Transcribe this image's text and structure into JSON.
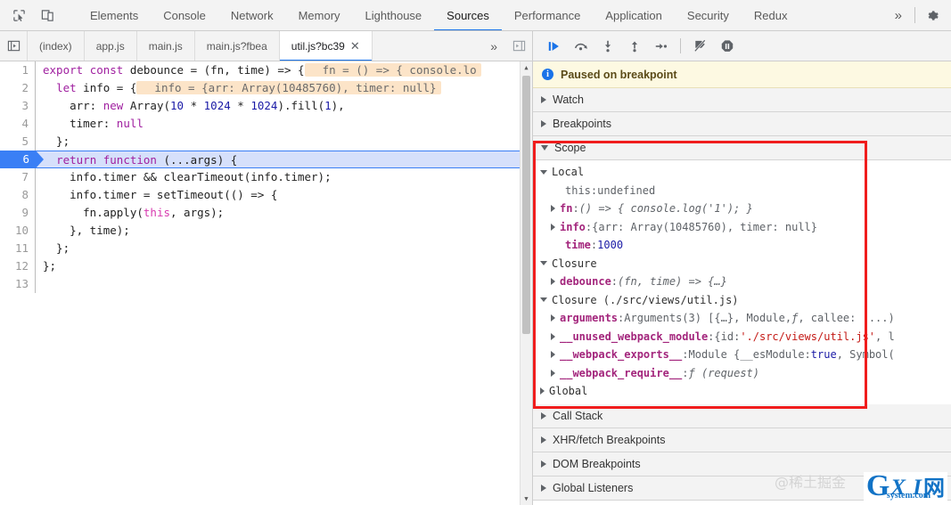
{
  "toolbar": {
    "inspect_icon": "inspect-element-icon",
    "device_icon": "device-toolbar-icon",
    "tabs": [
      {
        "label": "Elements",
        "active": false
      },
      {
        "label": "Console",
        "active": false
      },
      {
        "label": "Network",
        "active": false
      },
      {
        "label": "Memory",
        "active": false
      },
      {
        "label": "Lighthouse",
        "active": false
      },
      {
        "label": "Sources",
        "active": true
      },
      {
        "label": "Performance",
        "active": false
      },
      {
        "label": "Application",
        "active": false
      },
      {
        "label": "Security",
        "active": false
      },
      {
        "label": "Redux",
        "active": false
      }
    ],
    "more_label": "»",
    "settings_icon": "gear-icon",
    "accent_color": "#1a73e8"
  },
  "filebar": {
    "navigator_icon": "show-navigator-icon",
    "debugger_icon": "show-debugger-icon",
    "tabs": [
      {
        "label": "(index)",
        "active": false,
        "closable": false
      },
      {
        "label": "app.js",
        "active": false,
        "closable": false
      },
      {
        "label": "main.js",
        "active": false,
        "closable": false
      },
      {
        "label": "main.js?fbea",
        "active": false,
        "closable": false
      },
      {
        "label": "util.js?bc39",
        "active": true,
        "closable": true
      }
    ],
    "close_glyph": "✕",
    "more_label": "»"
  },
  "editor": {
    "execution_line": 6,
    "lines": [
      {
        "n": 1,
        "tokens": [
          {
            "t": "export",
            "c": "tk-kw"
          },
          {
            "t": " ",
            "c": "tk-pl"
          },
          {
            "t": "const",
            "c": "tk-kw"
          },
          {
            "t": " debounce = (fn, time) => {",
            "c": "tk-pl"
          }
        ],
        "hint": "fn = () => { console.lo"
      },
      {
        "n": 2,
        "tokens": [
          {
            "t": "  ",
            "c": "tk-pl"
          },
          {
            "t": "let",
            "c": "tk-kw"
          },
          {
            "t": " info = {",
            "c": "tk-pl"
          }
        ],
        "hint": "info = {arr: Array(10485760), timer: null}"
      },
      {
        "n": 3,
        "tokens": [
          {
            "t": "    arr: ",
            "c": "tk-pl"
          },
          {
            "t": "new",
            "c": "tk-kw"
          },
          {
            "t": " Array(",
            "c": "tk-pl"
          },
          {
            "t": "10",
            "c": "tk-num"
          },
          {
            "t": " * ",
            "c": "tk-pl"
          },
          {
            "t": "1024",
            "c": "tk-num"
          },
          {
            "t": " * ",
            "c": "tk-pl"
          },
          {
            "t": "1024",
            "c": "tk-num"
          },
          {
            "t": ").fill(",
            "c": "tk-pl"
          },
          {
            "t": "1",
            "c": "tk-num"
          },
          {
            "t": "),",
            "c": "tk-pl"
          }
        ],
        "hint": ""
      },
      {
        "n": 4,
        "tokens": [
          {
            "t": "    timer: ",
            "c": "tk-pl"
          },
          {
            "t": "null",
            "c": "tk-kw"
          }
        ],
        "hint": ""
      },
      {
        "n": 5,
        "tokens": [
          {
            "t": "  };",
            "c": "tk-pl"
          }
        ],
        "hint": ""
      },
      {
        "n": 6,
        "tokens": [
          {
            "t": "  ",
            "c": "tk-pl"
          },
          {
            "t": "return",
            "c": "tk-kw"
          },
          {
            "t": " ",
            "c": "tk-pl"
          },
          {
            "t": "function",
            "c": "tk-kw"
          },
          {
            "t": " (...args) {",
            "c": "tk-pl"
          }
        ],
        "hint": ""
      },
      {
        "n": 7,
        "tokens": [
          {
            "t": "    info.timer && clearTimeout(info.timer);",
            "c": "tk-pl"
          }
        ],
        "hint": ""
      },
      {
        "n": 8,
        "tokens": [
          {
            "t": "    info.timer = setTimeout(() => {",
            "c": "tk-pl"
          }
        ],
        "hint": ""
      },
      {
        "n": 9,
        "tokens": [
          {
            "t": "      fn.apply(",
            "c": "tk-pl"
          },
          {
            "t": "this",
            "c": "tk-this"
          },
          {
            "t": ", args);",
            "c": "tk-pl"
          }
        ],
        "hint": ""
      },
      {
        "n": 10,
        "tokens": [
          {
            "t": "    }, time);",
            "c": "tk-pl"
          }
        ],
        "hint": ""
      },
      {
        "n": 11,
        "tokens": [
          {
            "t": "  };",
            "c": "tk-pl"
          }
        ],
        "hint": ""
      },
      {
        "n": 12,
        "tokens": [
          {
            "t": "};",
            "c": "tk-pl"
          }
        ],
        "hint": ""
      },
      {
        "n": 13,
        "tokens": [],
        "hint": ""
      }
    ]
  },
  "debugger": {
    "buttons": [
      {
        "name": "resume-script-execution",
        "icon": "resume-icon"
      },
      {
        "name": "step-over-next-function-call",
        "icon": "step-over-icon"
      },
      {
        "name": "step-into-next-function-call",
        "icon": "step-into-icon"
      },
      {
        "name": "step-out-of-current-function",
        "icon": "step-out-icon"
      },
      {
        "name": "step",
        "icon": "step-icon"
      },
      {
        "name": "deactivate-breakpoints",
        "icon": "deactivate-breakpoints-icon"
      },
      {
        "name": "pause-on-exceptions",
        "icon": "pause-on-exceptions-icon"
      }
    ],
    "banner": {
      "icon": "info-icon",
      "text": "Paused on breakpoint",
      "bg": "#fdf9e2"
    },
    "sections": [
      {
        "label": "Watch",
        "expanded": false
      },
      {
        "label": "Breakpoints",
        "expanded": false
      },
      {
        "label": "Scope",
        "expanded": true
      },
      {
        "label": "Call Stack",
        "expanded": false
      },
      {
        "label": "XHR/fetch Breakpoints",
        "expanded": false
      },
      {
        "label": "DOM Breakpoints",
        "expanded": false
      },
      {
        "label": "Global Listeners",
        "expanded": false
      }
    ],
    "scope": [
      {
        "kind": "group",
        "indent": 0,
        "expanded": true,
        "label": "Local"
      },
      {
        "kind": "prop",
        "indent": 1,
        "arrow": false,
        "name": "this",
        "name_plain": true,
        "parts": [
          {
            "t": "undefined",
            "c": "pval"
          }
        ]
      },
      {
        "kind": "prop",
        "indent": 1,
        "arrow": true,
        "name": "fn",
        "parts": [
          {
            "t": "() => { console.log('1'); }",
            "c": "pval-fn"
          }
        ]
      },
      {
        "kind": "prop",
        "indent": 1,
        "arrow": true,
        "name": "info",
        "parts": [
          {
            "t": "{arr: Array(10485760), timer: null}",
            "c": "pval"
          }
        ]
      },
      {
        "kind": "prop",
        "indent": 1,
        "arrow": false,
        "name": "time",
        "parts": [
          {
            "t": "1000",
            "c": "pval-num"
          }
        ]
      },
      {
        "kind": "group",
        "indent": 0,
        "expanded": true,
        "label": "Closure"
      },
      {
        "kind": "prop",
        "indent": 1,
        "arrow": true,
        "name": "debounce",
        "parts": [
          {
            "t": "(fn, time) => {…}",
            "c": "pval-fn"
          }
        ]
      },
      {
        "kind": "group",
        "indent": 0,
        "expanded": true,
        "label": "Closure (./src/views/util.js)"
      },
      {
        "kind": "prop",
        "indent": 1,
        "arrow": true,
        "name": "arguments",
        "parts": [
          {
            "t": "Arguments(3) [{…}, Module, ",
            "c": "pval"
          },
          {
            "t": "ƒ",
            "c": "pval-fn"
          },
          {
            "t": ", callee: (...)",
            "c": "pval"
          }
        ]
      },
      {
        "kind": "prop",
        "indent": 1,
        "arrow": true,
        "name": "__unused_webpack_module",
        "parts": [
          {
            "t": "{id: ",
            "c": "pval"
          },
          {
            "t": "'./src/views/util.js'",
            "c": "pval-str"
          },
          {
            "t": ", l",
            "c": "pval"
          }
        ]
      },
      {
        "kind": "prop",
        "indent": 1,
        "arrow": true,
        "name": "__webpack_exports__",
        "parts": [
          {
            "t": "Module {__esModule: ",
            "c": "pval"
          },
          {
            "t": "true",
            "c": "pval-kw"
          },
          {
            "t": ", Symbol(",
            "c": "pval"
          }
        ]
      },
      {
        "kind": "prop",
        "indent": 1,
        "arrow": true,
        "name": "__webpack_require__",
        "parts": [
          {
            "t": "ƒ (request)",
            "c": "pval-fn"
          }
        ]
      },
      {
        "kind": "group",
        "indent": 0,
        "expanded": false,
        "label": "Global"
      }
    ]
  },
  "annotation": {
    "highlight_color": "#f01d1d",
    "label": "scope-highlight-box"
  },
  "watermarks": {
    "chinese": "@稀土掘金",
    "logo_g": "G",
    "logo_xi": "X I",
    "logo_net": "网",
    "logo_sub": "system.com"
  }
}
